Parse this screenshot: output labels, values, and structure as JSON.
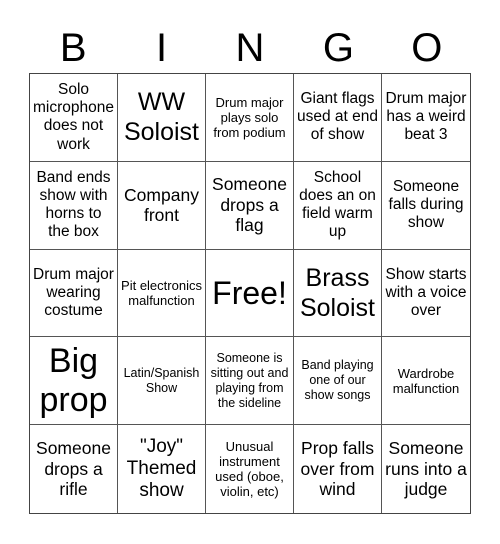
{
  "title_letters": [
    "B",
    "I",
    "N",
    "G",
    "O"
  ],
  "cells": [
    [
      "Solo microphone does not work",
      "WW Soloist",
      "Drum major plays solo from podium",
      "Giant flags used at end of show",
      "Drum major has a weird beat 3"
    ],
    [
      "Band ends show with horns to the box",
      "Company front",
      "Someone drops a flag",
      "School does an on field warm up",
      "Someone falls during show"
    ],
    [
      "Drum major wearing costume",
      "Pit electronics malfunction",
      "Free!",
      "Brass Soloist",
      "Show starts with a voice over"
    ],
    [
      "Big prop",
      "Latin/Spanish Show",
      "Someone is sitting out and playing from the sideline",
      "Band playing one of our show songs",
      "Wardrobe malfunction"
    ],
    [
      "Someone drops a rifle",
      "\"Joy\" Themed show",
      "Unusual instrument used (oboe, violin, etc)",
      "Prop falls over from wind",
      "Someone runs into a judge"
    ]
  ]
}
